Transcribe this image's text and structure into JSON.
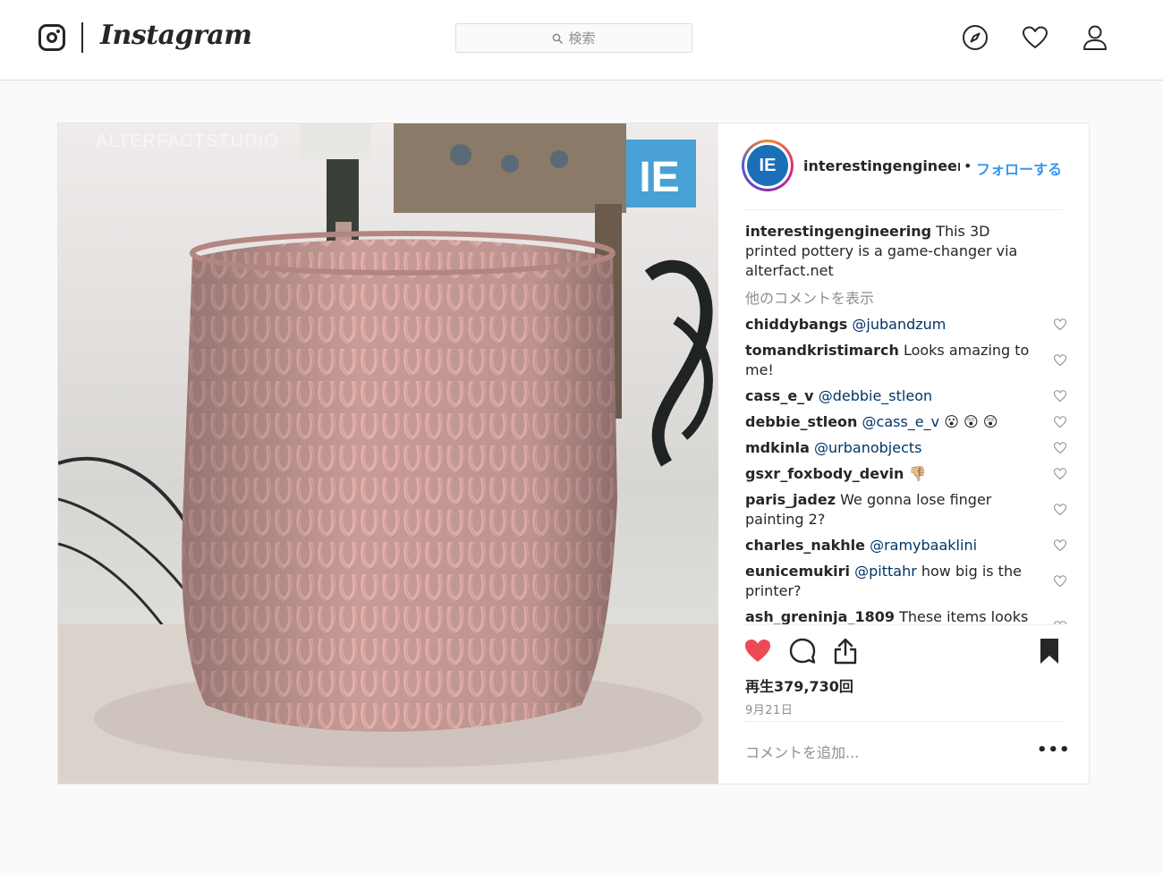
{
  "app": {
    "wordmark": "Instagram"
  },
  "search": {
    "placeholder": "検索"
  },
  "nav": {
    "icons": [
      "compass-icon",
      "heart-icon",
      "profile-icon"
    ]
  },
  "post": {
    "media_watermark": "ALTERFACTSTUDIO",
    "media_badge": "IE",
    "username": "interestingengineeri",
    "avatar_text": "IE",
    "bullet": "•",
    "follow_label": "フォローする",
    "caption": {
      "user": "interestingengineering",
      "text": " This 3D printed pottery is a game-changer via alterfact.net"
    },
    "more_comments": "他のコメントを表示",
    "comments": [
      {
        "user": "chiddybangs",
        "mention": "@jubandzum",
        "text": ""
      },
      {
        "user": "tomandkristimarch",
        "mention": "",
        "text": " Looks amazing to me!"
      },
      {
        "user": "cass_e_v",
        "mention": "@debbie_stleon",
        "text": ""
      },
      {
        "user": "debbie_stleon",
        "mention": "@cass_e_v",
        "text": " 😮 😲 😲"
      },
      {
        "user": "mdkinla",
        "mention": "@urbanobjects",
        "text": ""
      },
      {
        "user": "gsxr_foxbody_devin",
        "mention": "",
        "text": " 👎🏼"
      },
      {
        "user": "paris_jadez",
        "mention": "",
        "text": " We gonna lose finger painting 2?"
      },
      {
        "user": "charles_nakhle",
        "mention": "@ramybaaklini",
        "text": ""
      },
      {
        "user": "eunicemukiri",
        "mention": "@pittahr",
        "text": " how big is the printer?"
      },
      {
        "user": "ash_greninja_1809",
        "mention": "",
        "text": " These items looks like chocolate😅 😅 🙋 🙋"
      }
    ],
    "views": "再生379,730回",
    "date": "9月21日",
    "add_comment_placeholder": "コメントを追加...",
    "more_dots": "•••",
    "liked": true
  },
  "colors": {
    "like_red": "#ed4956",
    "follow_blue": "#3897f0",
    "mention_blue": "#003569",
    "muted": "#8e8e8e"
  }
}
